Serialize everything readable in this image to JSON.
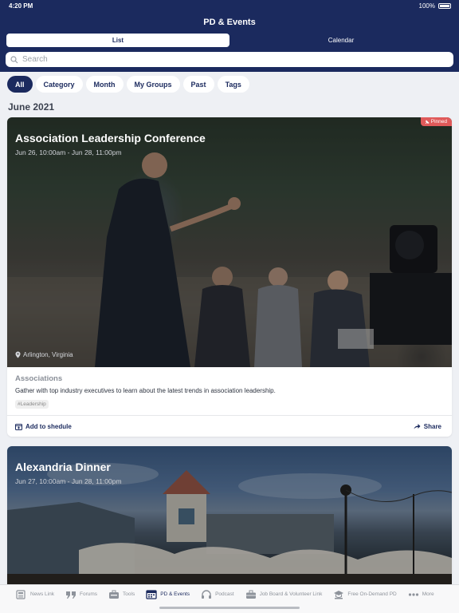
{
  "status_bar": {
    "time": "4:20 PM",
    "battery": "100%"
  },
  "header": {
    "title": "PD & Events"
  },
  "view_toggle": {
    "list_label": "List",
    "calendar_label": "Calendar"
  },
  "search": {
    "placeholder": "Search"
  },
  "filters": [
    {
      "label": "All",
      "active": true
    },
    {
      "label": "Category"
    },
    {
      "label": "Month"
    },
    {
      "label": "My Groups"
    },
    {
      "label": "Past"
    },
    {
      "label": "Tags"
    }
  ],
  "month_heading": "June 2021",
  "events": [
    {
      "title": "Association Leadership Conference",
      "dates": "Jun 26, 10:00am - Jun 28, 11:00pm",
      "badge": "Pinned",
      "location": "Arlington, Virginia",
      "category": "Associations",
      "description": "Gather with top industry executives to learn about the latest trends in association leadership.",
      "tag": "#Leadership",
      "add_label": "Add to shedule",
      "share_label": "Share"
    },
    {
      "title": "Alexandria Dinner",
      "dates": "Jun 27, 10:00am - Jun 28, 11:00pm"
    }
  ],
  "tabbar": [
    {
      "label": "News Link",
      "icon": "news-icon"
    },
    {
      "label": "Forums",
      "icon": "quote-icon"
    },
    {
      "label": "Tools",
      "icon": "toolbox-icon"
    },
    {
      "label": "PD & Events",
      "icon": "calendar-icon",
      "active": true
    },
    {
      "label": "Podcast",
      "icon": "headphones-icon"
    },
    {
      "label": "Job Board & Volunteer Link",
      "icon": "briefcase-icon"
    },
    {
      "label": "Free On-Demand PD",
      "icon": "graduation-icon"
    },
    {
      "label": "More",
      "icon": "more-icon"
    }
  ],
  "colors": {
    "brand_navy": "#1b2a5e",
    "pinned_red": "#e05a5a",
    "background": "#eef0f4"
  }
}
